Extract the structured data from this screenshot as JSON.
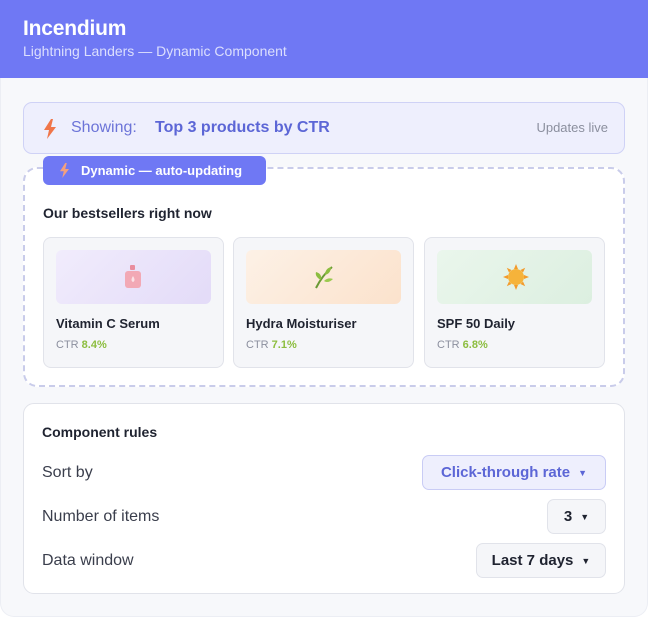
{
  "header": {
    "title": "Incendium",
    "subtitle": "Lightning Landers — Dynamic Component"
  },
  "showing": {
    "label": "Showing:",
    "value": "Top 3 products by CTR",
    "status": "Updates live"
  },
  "dynamic": {
    "badge": "Dynamic — auto-updating",
    "heading": "Our bestsellers right now",
    "ctr_prefix": "CTR",
    "products": [
      {
        "name": "Vitamin C Serum",
        "ctr": "8.4%",
        "icon": "serum-bottle-icon",
        "bg": "#ece7fb"
      },
      {
        "name": "Hydra Moisturiser",
        "ctr": "7.1%",
        "icon": "leaf-icon",
        "bg": "#fdeedd"
      },
      {
        "name": "SPF 50 Daily",
        "ctr": "6.8%",
        "icon": "sun-icon",
        "bg": "#e5f3e8"
      }
    ]
  },
  "rules": {
    "title": "Component rules",
    "sort_label": "Sort by",
    "sort_value": "Click-through rate",
    "items_label": "Number of items",
    "items_value": "3",
    "window_label": "Data window",
    "window_value": "Last 7 days"
  },
  "colors": {
    "accent": "#6f78f4",
    "ctr_green": "#8cbd3f",
    "bolt_orange": "#f0764a"
  }
}
